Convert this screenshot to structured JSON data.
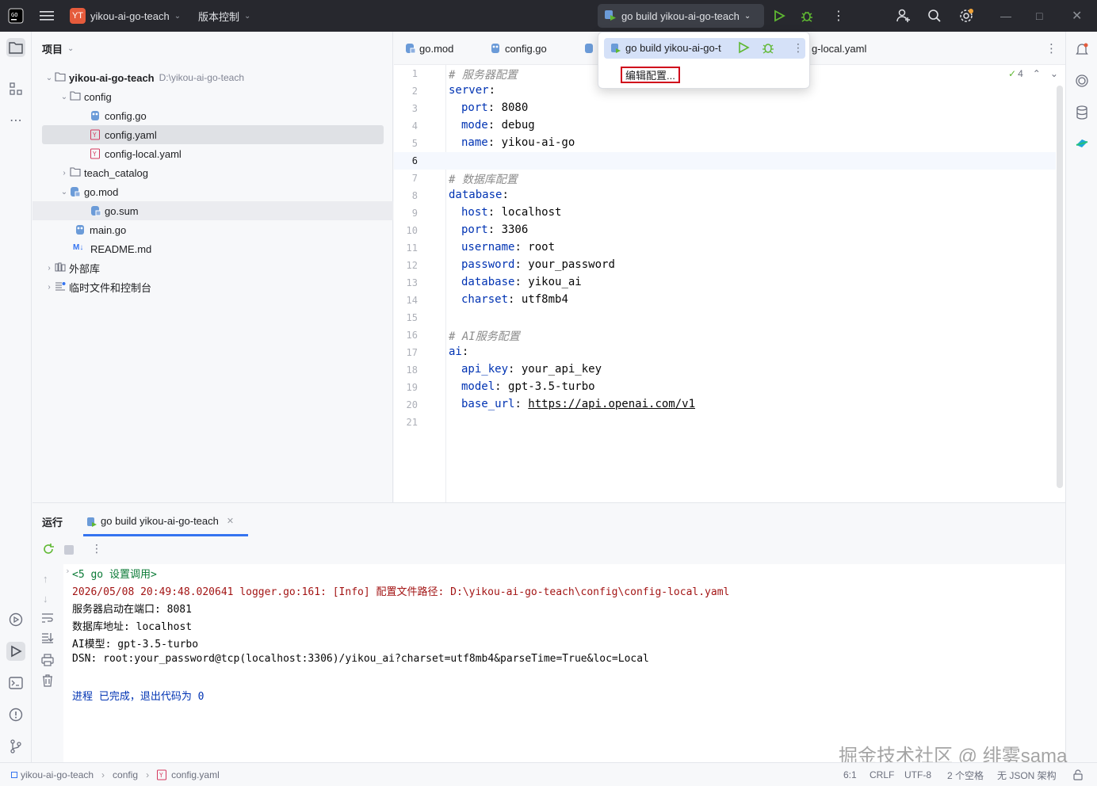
{
  "titlebar": {
    "project_badge": "YT",
    "project_name": "yikou-ai-go-teach",
    "vcs_menu": "版本控制",
    "run_config": "go build yikou-ai-go-teach",
    "icons": [
      "app-logo-icon",
      "hamburger-menu-icon",
      "run-icon",
      "debug-icon",
      "more-icon",
      "add-user-icon",
      "search-icon",
      "settings-icon",
      "minimize-icon",
      "maximize-icon",
      "close-icon"
    ]
  },
  "project_panel": {
    "title": "项目",
    "root": {
      "name": "yikou-ai-go-teach",
      "path": "D:\\yikou-ai-go-teach"
    },
    "items": [
      {
        "label": "config"
      },
      {
        "label": "config.go"
      },
      {
        "label": "config.yaml"
      },
      {
        "label": "config-local.yaml"
      },
      {
        "label": "teach_catalog"
      },
      {
        "label": "go.mod"
      },
      {
        "label": "go.sum"
      },
      {
        "label": "main.go"
      },
      {
        "label": "README.md"
      },
      {
        "label": "外部库"
      },
      {
        "label": "临时文件和控制台"
      }
    ]
  },
  "editor": {
    "tabs": [
      {
        "label": "go.mod"
      },
      {
        "label": "config.go"
      },
      {
        "label": "g-local.yaml"
      }
    ],
    "inspection_count": "4",
    "lines": [
      {
        "n": "1",
        "text": "# 服务器配置"
      },
      {
        "n": "2",
        "key": "server",
        "val": ""
      },
      {
        "n": "3",
        "key": "port",
        "val": "8080"
      },
      {
        "n": "4",
        "key": "mode",
        "val": "debug"
      },
      {
        "n": "5",
        "key": "name",
        "val": "yikou-ai-go"
      },
      {
        "n": "6",
        "text": ""
      },
      {
        "n": "7",
        "text": "# 数据库配置"
      },
      {
        "n": "8",
        "key": "database",
        "val": ""
      },
      {
        "n": "9",
        "key": "host",
        "val": "localhost"
      },
      {
        "n": "10",
        "key": "port",
        "val": "3306"
      },
      {
        "n": "11",
        "key": "username",
        "val": "root"
      },
      {
        "n": "12",
        "key": "password",
        "val": "your_password"
      },
      {
        "n": "13",
        "key": "database",
        "val": "yikou_ai"
      },
      {
        "n": "14",
        "key": "charset",
        "val": "utf8mb4"
      },
      {
        "n": "15",
        "text": ""
      },
      {
        "n": "16",
        "text": "# AI服务配置"
      },
      {
        "n": "17",
        "key": "ai",
        "val": ""
      },
      {
        "n": "18",
        "key": "api_key",
        "val": "your_api_key"
      },
      {
        "n": "19",
        "key": "model",
        "val": "gpt-3.5-turbo"
      },
      {
        "n": "20",
        "key": "base_url",
        "val": "https://api.openai.com/v1"
      },
      {
        "n": "21",
        "text": ""
      }
    ]
  },
  "popup": {
    "run_item": "go build yikou-ai-go-t",
    "edit_config": "编辑配置..."
  },
  "run_panel": {
    "title": "运行",
    "tab_label": "go build yikou-ai-go-teach",
    "console": [
      "<5 go 设置调用>",
      "2026/05/08 20:49:48.020641 logger.go:161: [Info] 配置文件路径: D:\\yikou-ai-go-teach\\config\\config-local.yaml",
      "服务器启动在端口: 8081",
      "数据库地址: localhost",
      "AI模型: gpt-3.5-turbo",
      "DSN: root:your_password@tcp(localhost:3306)/yikou_ai?charset=utf8mb4&parseTime=True&loc=Local",
      "",
      "进程 已完成，退出代码为 0"
    ]
  },
  "statusbar": {
    "breadcrumb": [
      "yikou-ai-go-teach",
      "config",
      "config.yaml"
    ],
    "position": "6:1",
    "line_sep": "CRLF",
    "encoding": "UTF-8",
    "indent": "2 个空格",
    "schema": "无 JSON 架构"
  },
  "watermark": "掘金技术社区 @ 绯雾sama",
  "colors": {
    "accent": "#3574f0",
    "keyword": "#0033b3",
    "titlebar": "#27282e",
    "highlight_box": "#d0021b",
    "run_green": "#5fb832"
  }
}
